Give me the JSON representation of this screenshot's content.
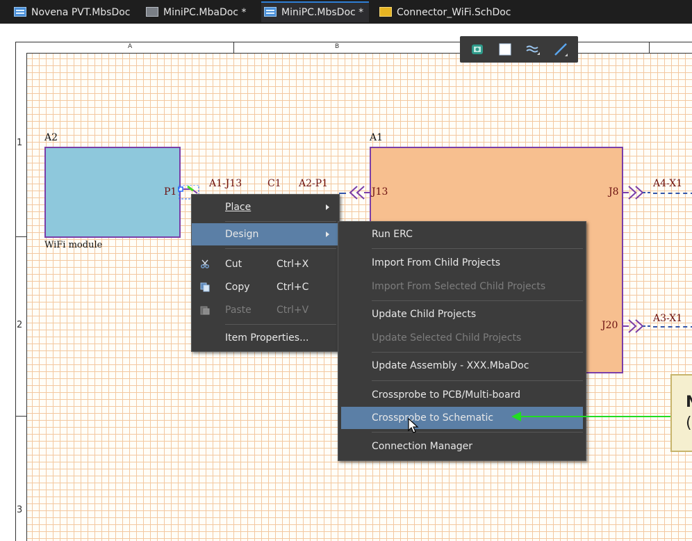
{
  "tabs": [
    {
      "label": "Novena PVT.MbsDoc",
      "icon": "multiboard-schematic-icon",
      "active": false
    },
    {
      "label": "MiniPC.MbaDoc *",
      "icon": "multiboard-assembly-icon",
      "active": false
    },
    {
      "label": "MiniPC.MbsDoc *",
      "icon": "multiboard-schematic-icon",
      "active": true
    },
    {
      "label": "Connector_WiFi.SchDoc",
      "icon": "schematic-icon",
      "active": false
    }
  ],
  "ruler": {
    "col_a": "A",
    "col_b": "B",
    "row_1": "1",
    "row_2": "2",
    "row_3": "3"
  },
  "schematic": {
    "block_a2_designator": "A2",
    "block_a2_name": "WiFi module",
    "port_p1": "P1",
    "wire_label_a1j13": "A1-J13",
    "wire_label_c1": "C1",
    "wire_label_a2p1": "A2-P1",
    "block_a1_designator": "A1",
    "port_j13": "J13",
    "port_j8": "J8",
    "port_j20": "J20",
    "net_a4x1": "A4-X1",
    "net_a3x1": "A3-X1"
  },
  "context_menu": {
    "place": "Place",
    "design": "Design",
    "cut": "Cut",
    "cut_shortcut": "Ctrl+X",
    "copy": "Copy",
    "copy_shortcut": "Ctrl+C",
    "paste": "Paste",
    "paste_shortcut": "Ctrl+V",
    "item_properties": "Item Properties..."
  },
  "design_submenu": {
    "run_erc": "Run ERC",
    "import_child": "Import From Child Projects",
    "import_selected": "Import From Selected Child Projects",
    "update_child": "Update Child Projects",
    "update_selected": "Update Selected Child Projects",
    "update_assembly": "Update Assembly - XXX.MbaDoc",
    "crossprobe_pcb": "Crossprobe to PCB/Multi-board",
    "crossprobe_sch": "Crossprobe to Schematic",
    "connection_manager": "Connection Manager"
  },
  "note": {
    "line1": "N",
    "line2": "("
  },
  "colors": {
    "accent": "#5b7fa6",
    "arrow": "#22dd22",
    "block_a1": "#f7bf8f",
    "block_a2": "#8ec8dc"
  }
}
